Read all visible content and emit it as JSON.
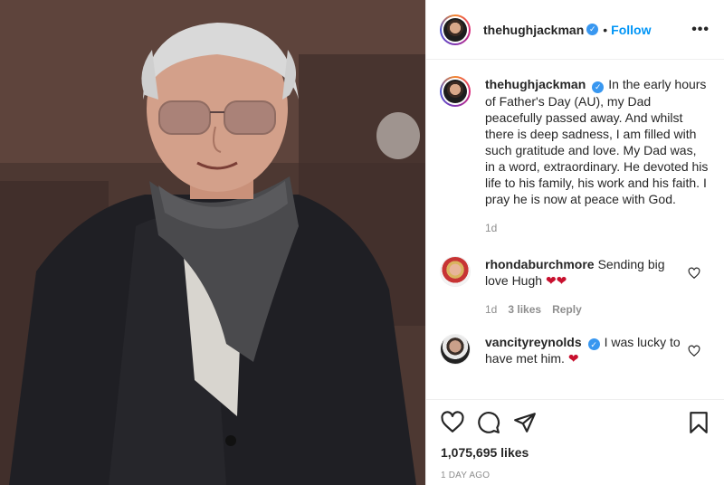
{
  "post": {
    "username": "thehughjackman",
    "verified_mark": "✓",
    "separator": "•",
    "follow_label": "Follow",
    "more_label": "•••"
  },
  "caption": {
    "username": "thehughjackman",
    "text": "In the early hours of Father's Day (AU), my Dad peacefully passed away. And whilst there is deep sadness, I am filled with such gratitude and love. My Dad was, in a word, extraordinary. He devoted his life to his family, his work and his faith. I pray he is now at peace with God.",
    "time": "1d"
  },
  "comments": [
    {
      "username": "rhondaburchmore",
      "text": "Sending big love Hugh",
      "emoji": "❤❤",
      "time": "1d",
      "likes": "3 likes",
      "reply": "Reply"
    },
    {
      "username": "vancityreynolds",
      "text": "I was lucky to have met him.",
      "emoji": "❤"
    }
  ],
  "actions": {
    "like_icon": "heart-outline-icon",
    "comment_icon": "comment-bubble-icon",
    "share_icon": "paper-plane-icon",
    "save_icon": "bookmark-icon"
  },
  "stats": {
    "likes": "1,075,695 likes",
    "posted": "1 DAY AGO"
  },
  "colors": {
    "accent": "#0095f6",
    "verified": "#3897f0",
    "heart": "#c8102e"
  }
}
